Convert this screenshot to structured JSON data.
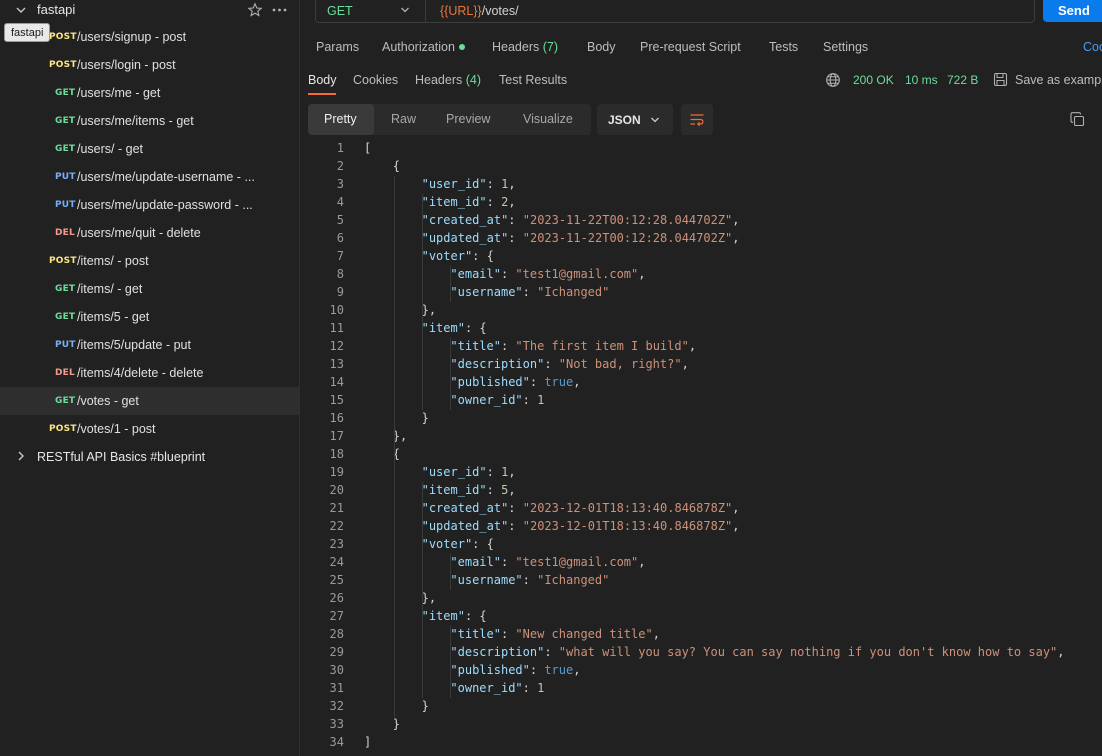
{
  "sidebar": {
    "collection_name": "fastapi",
    "tooltip": "fastapi",
    "items": [
      {
        "method": "POST",
        "label": "/users/signup - post"
      },
      {
        "method": "POST",
        "label": "/users/login - post"
      },
      {
        "method": "GET",
        "label": "/users/me - get"
      },
      {
        "method": "GET",
        "label": "/users/me/items - get"
      },
      {
        "method": "GET",
        "label": "/users/ - get"
      },
      {
        "method": "PUT",
        "label": "/users/me/update-username - ..."
      },
      {
        "method": "PUT",
        "label": "/users/me/update-password - ..."
      },
      {
        "method": "DEL",
        "label": "/users/me/quit - delete"
      },
      {
        "method": "POST",
        "label": "/items/ - post"
      },
      {
        "method": "GET",
        "label": "/items/ - get"
      },
      {
        "method": "GET",
        "label": "/items/5 - get"
      },
      {
        "method": "PUT",
        "label": "/items/5/update - put"
      },
      {
        "method": "DEL",
        "label": "/items/4/delete - delete"
      },
      {
        "method": "GET",
        "label": "/votes - get"
      },
      {
        "method": "POST",
        "label": "/votes/1 - post"
      }
    ],
    "selected_index": 13,
    "other_collection": "RESTful API Basics #blueprint"
  },
  "request": {
    "method": "GET",
    "url_var": "{{URL}}",
    "url_path": "/votes/",
    "send_label": "Send",
    "tabs": {
      "params": "Params",
      "authorization": "Authorization",
      "headers": "Headers",
      "headers_count": "(7)",
      "body": "Body",
      "prerequest": "Pre-request Script",
      "tests": "Tests",
      "settings": "Settings",
      "cookies": "Coo"
    }
  },
  "response": {
    "tabs": {
      "body": "Body",
      "cookies": "Cookies",
      "headers": "Headers",
      "headers_count": "(4)",
      "test_results": "Test Results"
    },
    "status": "200 OK",
    "time": "10 ms",
    "size": "722 B",
    "save_example": "Save as exampl",
    "formats": [
      "Pretty",
      "Raw",
      "Preview",
      "Visualize"
    ],
    "active_format": "Pretty",
    "language": "JSON"
  },
  "code_lines": [
    {
      "indent": 0,
      "parts": [
        [
          "p",
          "["
        ]
      ]
    },
    {
      "indent": 1,
      "parts": [
        [
          "p",
          "{"
        ]
      ]
    },
    {
      "indent": 2,
      "parts": [
        [
          "k",
          "\"user_id\""
        ],
        [
          "p",
          ": "
        ],
        [
          "n",
          "1"
        ],
        [
          "p",
          ","
        ]
      ]
    },
    {
      "indent": 2,
      "parts": [
        [
          "k",
          "\"item_id\""
        ],
        [
          "p",
          ": "
        ],
        [
          "n",
          "2"
        ],
        [
          "p",
          ","
        ]
      ]
    },
    {
      "indent": 2,
      "parts": [
        [
          "k",
          "\"created_at\""
        ],
        [
          "p",
          ": "
        ],
        [
          "s",
          "\"2023-11-22T00:12:28.044702Z\""
        ],
        [
          "p",
          ","
        ]
      ]
    },
    {
      "indent": 2,
      "parts": [
        [
          "k",
          "\"updated_at\""
        ],
        [
          "p",
          ": "
        ],
        [
          "s",
          "\"2023-11-22T00:12:28.044702Z\""
        ],
        [
          "p",
          ","
        ]
      ]
    },
    {
      "indent": 2,
      "parts": [
        [
          "k",
          "\"voter\""
        ],
        [
          "p",
          ": {"
        ]
      ]
    },
    {
      "indent": 3,
      "parts": [
        [
          "k",
          "\"email\""
        ],
        [
          "p",
          ": "
        ],
        [
          "s",
          "\"test1@gmail.com\""
        ],
        [
          "p",
          ","
        ]
      ]
    },
    {
      "indent": 3,
      "parts": [
        [
          "k",
          "\"username\""
        ],
        [
          "p",
          ": "
        ],
        [
          "s",
          "\"Ichanged\""
        ]
      ]
    },
    {
      "indent": 2,
      "parts": [
        [
          "p",
          "},"
        ]
      ]
    },
    {
      "indent": 2,
      "parts": [
        [
          "k",
          "\"item\""
        ],
        [
          "p",
          ": {"
        ]
      ]
    },
    {
      "indent": 3,
      "parts": [
        [
          "k",
          "\"title\""
        ],
        [
          "p",
          ": "
        ],
        [
          "s",
          "\"The first item I build\""
        ],
        [
          "p",
          ","
        ]
      ]
    },
    {
      "indent": 3,
      "parts": [
        [
          "k",
          "\"description\""
        ],
        [
          "p",
          ": "
        ],
        [
          "s",
          "\"Not bad, right?\""
        ],
        [
          "p",
          ","
        ]
      ]
    },
    {
      "indent": 3,
      "parts": [
        [
          "k",
          "\"published\""
        ],
        [
          "p",
          ": "
        ],
        [
          "b",
          "true"
        ],
        [
          "p",
          ","
        ]
      ]
    },
    {
      "indent": 3,
      "parts": [
        [
          "k",
          "\"owner_id\""
        ],
        [
          "p",
          ": "
        ],
        [
          "n",
          "1"
        ]
      ]
    },
    {
      "indent": 2,
      "parts": [
        [
          "p",
          "}"
        ]
      ]
    },
    {
      "indent": 1,
      "parts": [
        [
          "p",
          "},"
        ]
      ]
    },
    {
      "indent": 1,
      "parts": [
        [
          "p",
          "{"
        ]
      ]
    },
    {
      "indent": 2,
      "parts": [
        [
          "k",
          "\"user_id\""
        ],
        [
          "p",
          ": "
        ],
        [
          "n",
          "1"
        ],
        [
          "p",
          ","
        ]
      ]
    },
    {
      "indent": 2,
      "parts": [
        [
          "k",
          "\"item_id\""
        ],
        [
          "p",
          ": "
        ],
        [
          "n",
          "5"
        ],
        [
          "p",
          ","
        ]
      ]
    },
    {
      "indent": 2,
      "parts": [
        [
          "k",
          "\"created_at\""
        ],
        [
          "p",
          ": "
        ],
        [
          "s",
          "\"2023-12-01T18:13:40.846878Z\""
        ],
        [
          "p",
          ","
        ]
      ]
    },
    {
      "indent": 2,
      "parts": [
        [
          "k",
          "\"updated_at\""
        ],
        [
          "p",
          ": "
        ],
        [
          "s",
          "\"2023-12-01T18:13:40.846878Z\""
        ],
        [
          "p",
          ","
        ]
      ]
    },
    {
      "indent": 2,
      "parts": [
        [
          "k",
          "\"voter\""
        ],
        [
          "p",
          ": {"
        ]
      ]
    },
    {
      "indent": 3,
      "parts": [
        [
          "k",
          "\"email\""
        ],
        [
          "p",
          ": "
        ],
        [
          "s",
          "\"test1@gmail.com\""
        ],
        [
          "p",
          ","
        ]
      ]
    },
    {
      "indent": 3,
      "parts": [
        [
          "k",
          "\"username\""
        ],
        [
          "p",
          ": "
        ],
        [
          "s",
          "\"Ichanged\""
        ]
      ]
    },
    {
      "indent": 2,
      "parts": [
        [
          "p",
          "},"
        ]
      ]
    },
    {
      "indent": 2,
      "parts": [
        [
          "k",
          "\"item\""
        ],
        [
          "p",
          ": {"
        ]
      ]
    },
    {
      "indent": 3,
      "parts": [
        [
          "k",
          "\"title\""
        ],
        [
          "p",
          ": "
        ],
        [
          "s",
          "\"New changed title\""
        ],
        [
          "p",
          ","
        ]
      ]
    },
    {
      "indent": 3,
      "parts": [
        [
          "k",
          "\"description\""
        ],
        [
          "p",
          ": "
        ],
        [
          "s",
          "\"what will you say? You can say nothing if you don't know how to say\""
        ],
        [
          "p",
          ","
        ]
      ]
    },
    {
      "indent": 3,
      "parts": [
        [
          "k",
          "\"published\""
        ],
        [
          "p",
          ": "
        ],
        [
          "b",
          "true"
        ],
        [
          "p",
          ","
        ]
      ]
    },
    {
      "indent": 3,
      "parts": [
        [
          "k",
          "\"owner_id\""
        ],
        [
          "p",
          ": "
        ],
        [
          "n",
          "1"
        ]
      ]
    },
    {
      "indent": 2,
      "parts": [
        [
          "p",
          "}"
        ]
      ]
    },
    {
      "indent": 1,
      "parts": [
        [
          "p",
          "}"
        ]
      ]
    },
    {
      "indent": 0,
      "parts": [
        [
          "p",
          "]"
        ]
      ]
    }
  ],
  "colors": {
    "get": "#6bdd9a",
    "post": "#ffe47e",
    "put": "#74aef6",
    "del": "#f79a8e",
    "send": "#097bed",
    "accent": "#f76934"
  },
  "icons": [
    "chevron-down-icon",
    "chevron-right-icon",
    "star-icon",
    "more-icon",
    "globe-icon",
    "save-icon",
    "copy-icon",
    "wrap-icon"
  ]
}
